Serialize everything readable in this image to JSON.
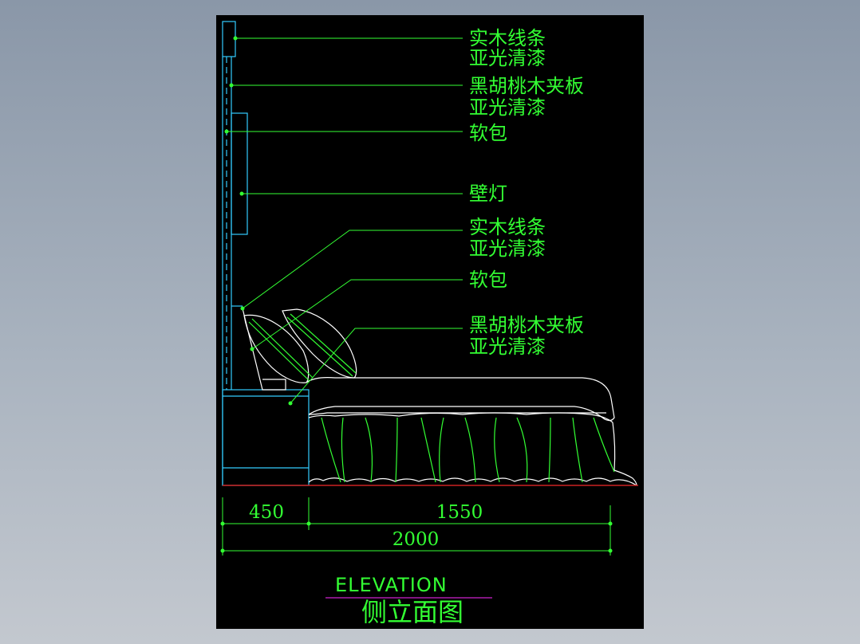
{
  "colors": {
    "background": "#8a97a8",
    "drawing_bg": "#000000",
    "leader": "#33ff33",
    "cabinet": "#33ccff",
    "outline": "#ffffff",
    "floor": "#cc2222",
    "title_underline": "#cc22cc"
  },
  "labels": [
    {
      "lines": [
        "实木线条",
        "亚光清漆"
      ]
    },
    {
      "lines": [
        "黑胡桃木夹板",
        "亚光清漆"
      ]
    },
    {
      "lines": [
        "软包"
      ]
    },
    {
      "lines": [
        "壁灯"
      ]
    },
    {
      "lines": [
        "实木线条",
        "亚光清漆"
      ]
    },
    {
      "lines": [
        "软包"
      ]
    },
    {
      "lines": [
        "黑胡桃木夹板",
        "亚光清漆"
      ]
    }
  ],
  "dimensions": {
    "nightstand": "450",
    "bed": "1550",
    "total": "2000"
  },
  "title": {
    "english": "ELEVATION",
    "chinese": "侧立面图"
  }
}
